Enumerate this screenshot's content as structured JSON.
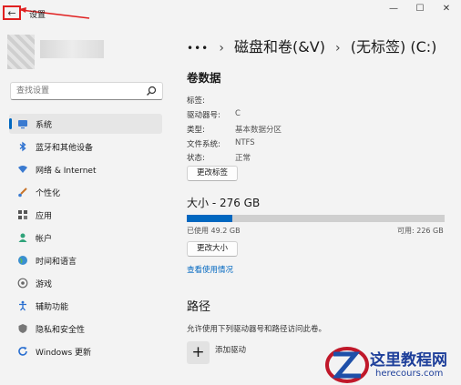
{
  "window": {
    "title": "设置",
    "back_glyph": "←",
    "minimize_glyph": "—",
    "maximize_glyph": "☐",
    "close_glyph": "✕"
  },
  "search": {
    "placeholder": "查找设置"
  },
  "sidebar": {
    "items": [
      {
        "label": "系统",
        "icon": "monitor-icon",
        "selected": true
      },
      {
        "label": "蓝牙和其他设备",
        "icon": "bluetooth-icon"
      },
      {
        "label": "网络 & Internet",
        "icon": "wifi-icon"
      },
      {
        "label": "个性化",
        "icon": "brush-icon"
      },
      {
        "label": "应用",
        "icon": "apps-icon"
      },
      {
        "label": "帐户",
        "icon": "person-icon"
      },
      {
        "label": "时间和语言",
        "icon": "globe-icon"
      },
      {
        "label": "游戏",
        "icon": "gamepad-icon"
      },
      {
        "label": "辅助功能",
        "icon": "accessibility-icon"
      },
      {
        "label": "隐私和安全性",
        "icon": "shield-icon"
      },
      {
        "label": "Windows 更新",
        "icon": "update-icon"
      }
    ]
  },
  "breadcrumb": {
    "more": "•••",
    "sep": "›",
    "parent": "磁盘和卷(&V)",
    "current": "(无标签) (C:)"
  },
  "volume": {
    "title": "卷数据",
    "props": [
      {
        "label": "标签:",
        "value": ""
      },
      {
        "label": "驱动器号:",
        "value": "C"
      },
      {
        "label": "类型:",
        "value": "基本数据分区"
      },
      {
        "label": "文件系统:",
        "value": "NTFS"
      },
      {
        "label": "状态:",
        "value": "正常"
      }
    ],
    "change_label_button": "更改标签"
  },
  "size": {
    "title": "大小 - 276 GB",
    "used_text": "已使用 49.2 GB",
    "free_text": "可用: 226 GB",
    "used_fraction": 0.178,
    "resize_button": "更改大小",
    "usage_link": "查看使用情况"
  },
  "paths": {
    "title": "路径",
    "description": "允许使用下列驱动器号和路径访问此卷。",
    "add_glyph": "+",
    "add_label": "添加驱动"
  },
  "watermark": {
    "title": "这里教程网",
    "url": "herecours.com"
  },
  "colors": {
    "accent": "#0067c0",
    "highlight_red": "#e02020",
    "background": "#f3f3f3"
  }
}
